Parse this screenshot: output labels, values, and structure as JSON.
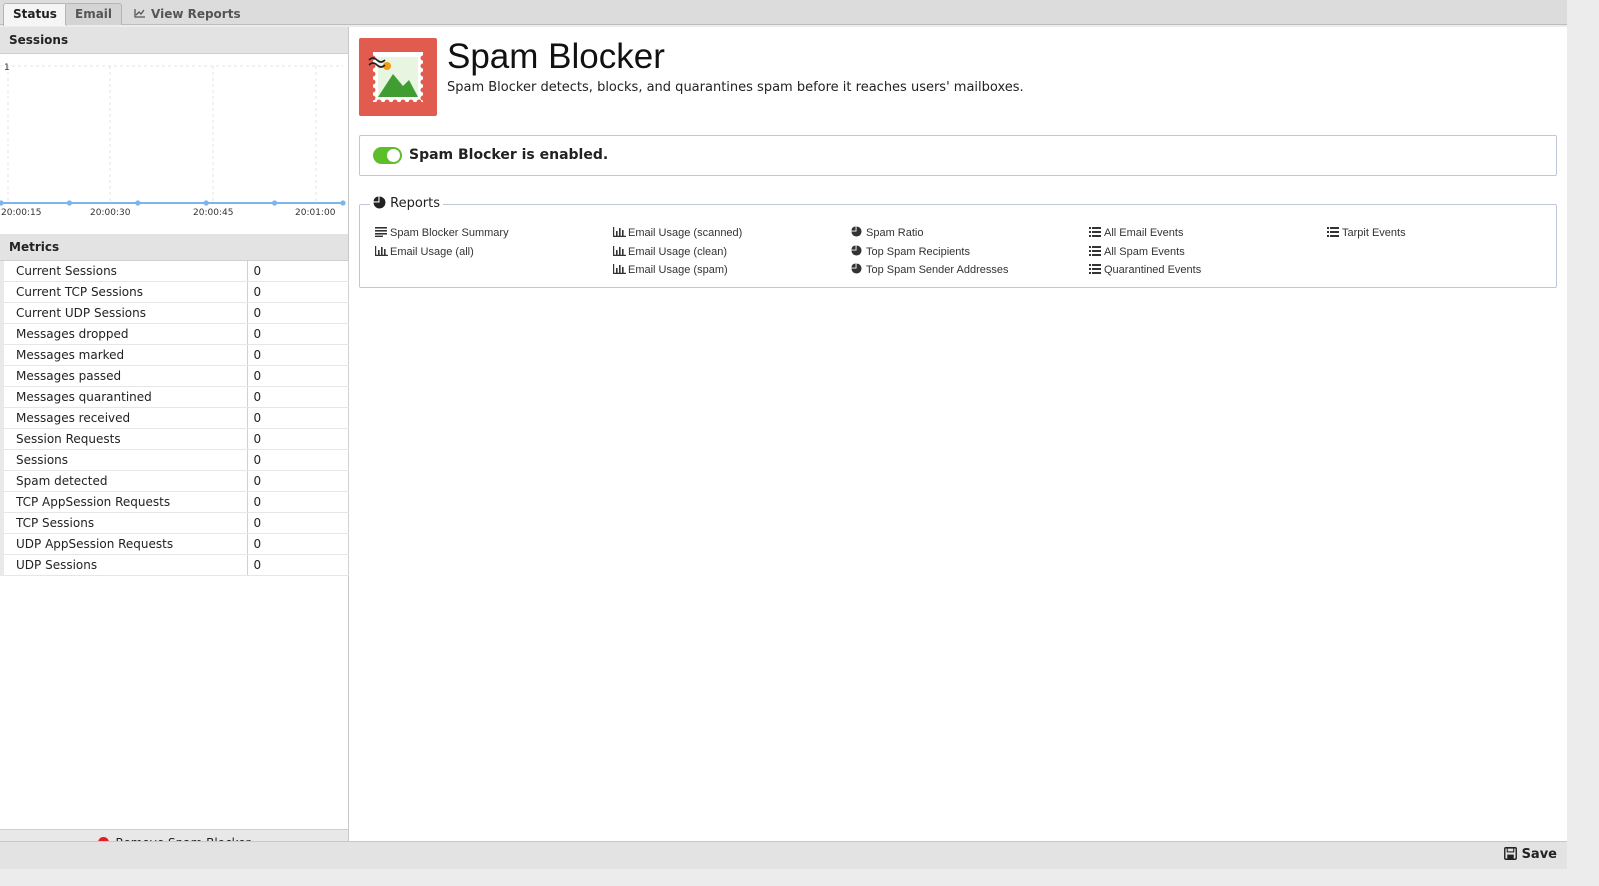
{
  "tabs": [
    {
      "label": "Status",
      "active": true
    },
    {
      "label": "Email",
      "active": false
    },
    {
      "label": "View Reports",
      "active": false,
      "icon": "line-chart-icon"
    }
  ],
  "sessions": {
    "title": "Sessions",
    "chart_data": {
      "type": "line",
      "x": [
        "20:00:15",
        "20:00:30",
        "20:00:45",
        "20:01:00"
      ],
      "y_tick_top": "1",
      "series": [
        {
          "values": [
            0,
            0,
            0,
            0,
            0,
            0
          ]
        }
      ],
      "color": "#7cb5ec"
    }
  },
  "metrics": {
    "title": "Metrics",
    "rows": [
      {
        "name": "Current Sessions",
        "value": "0"
      },
      {
        "name": "Current TCP Sessions",
        "value": "0"
      },
      {
        "name": "Current UDP Sessions",
        "value": "0"
      },
      {
        "name": "Messages dropped",
        "value": "0"
      },
      {
        "name": "Messages marked",
        "value": "0"
      },
      {
        "name": "Messages passed",
        "value": "0"
      },
      {
        "name": "Messages quarantined",
        "value": "0"
      },
      {
        "name": "Messages received",
        "value": "0"
      },
      {
        "name": "Session Requests",
        "value": "0"
      },
      {
        "name": "Sessions",
        "value": "0"
      },
      {
        "name": "Spam detected",
        "value": "0"
      },
      {
        "name": "TCP AppSession Requests",
        "value": "0"
      },
      {
        "name": "TCP Sessions",
        "value": "0"
      },
      {
        "name": "UDP AppSession Requests",
        "value": "0"
      },
      {
        "name": "UDP Sessions",
        "value": "0"
      }
    ]
  },
  "remove_label": "Remove Spam Blocker",
  "app": {
    "title": "Spam Blocker",
    "description": "Spam Blocker detects, blocks, and quarantines spam before it reaches users' mailboxes.",
    "enabled_text": "Spam Blocker is enabled.",
    "accent": "#e25b4f",
    "toggle_color": "#5cbf2a"
  },
  "reports": {
    "legend": "Reports",
    "columns": [
      [
        {
          "label": "Spam Blocker Summary",
          "icon": "text-icon"
        },
        {
          "label": "Email Usage (all)",
          "icon": "bar-chart-icon"
        }
      ],
      [
        {
          "label": "Email Usage (scanned)",
          "icon": "bar-chart-icon"
        },
        {
          "label": "Email Usage (clean)",
          "icon": "bar-chart-icon"
        },
        {
          "label": "Email Usage (spam)",
          "icon": "bar-chart-icon"
        }
      ],
      [
        {
          "label": "Spam Ratio",
          "icon": "pie-chart-icon"
        },
        {
          "label": "Top Spam Recipients",
          "icon": "pie-chart-icon"
        },
        {
          "label": "Top Spam Sender Addresses",
          "icon": "pie-chart-icon"
        }
      ],
      [
        {
          "label": "All Email Events",
          "icon": "list-icon"
        },
        {
          "label": "All Spam Events",
          "icon": "list-icon"
        },
        {
          "label": "Quarantined Events",
          "icon": "list-icon"
        }
      ],
      [
        {
          "label": "Tarpit Events",
          "icon": "list-icon"
        }
      ]
    ]
  },
  "save_label": "Save"
}
